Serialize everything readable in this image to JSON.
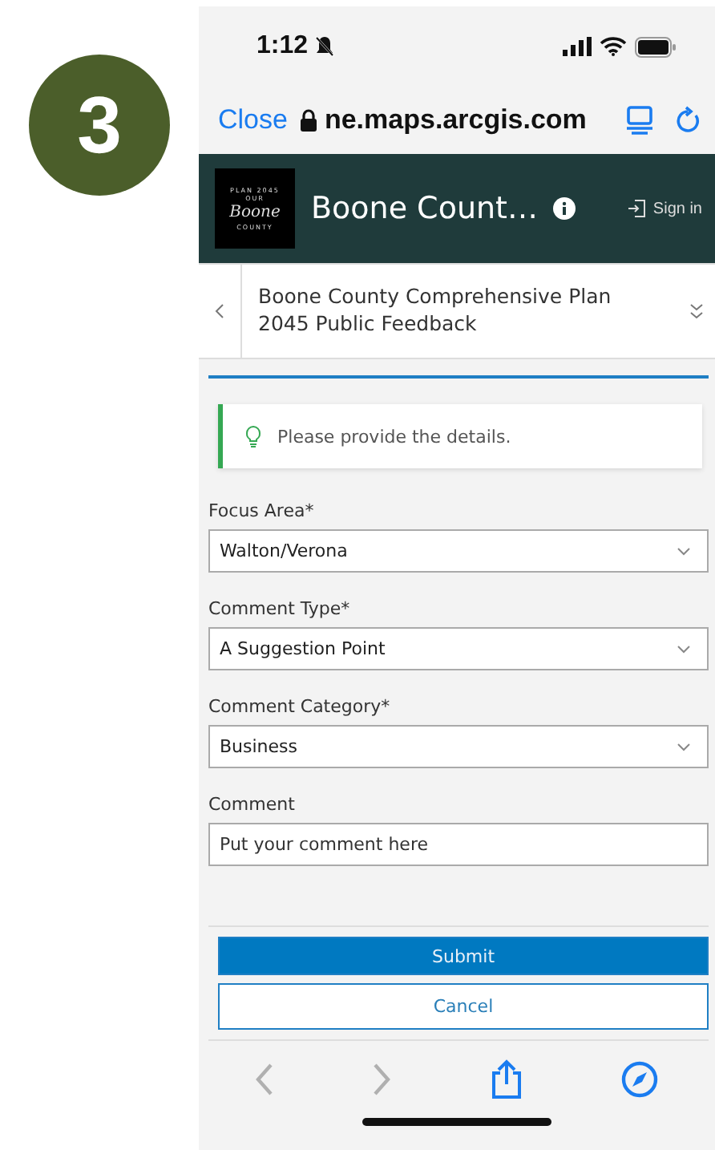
{
  "step_badge": {
    "number": "3"
  },
  "status_bar": {
    "time": "1:12"
  },
  "browser": {
    "close": "Close",
    "url": "ne.maps.arcgis.com"
  },
  "app_header": {
    "logo_lines": [
      "PLAN 2045",
      "OUR",
      "Boone",
      "COUNTY"
    ],
    "title": "Boone Count…",
    "sign_in": "Sign in"
  },
  "form_header": {
    "title": "Boone County Comprehensive Plan 2045 Public Feedback"
  },
  "tip": {
    "text": "Please provide the details."
  },
  "fields": [
    {
      "kind": "select",
      "label": "Focus Area*",
      "value": "Walton/Verona"
    },
    {
      "kind": "select",
      "label": "Comment Type*",
      "value": "A Suggestion Point"
    },
    {
      "kind": "select",
      "label": "Comment Category*",
      "value": "Business"
    },
    {
      "kind": "text",
      "label": "Comment",
      "placeholder": "Put your comment here"
    }
  ],
  "buttons": [
    {
      "kind": "primary",
      "label": "Submit"
    },
    {
      "kind": "secondary",
      "label": "Cancel"
    }
  ],
  "toolbar": [
    {
      "kind": "back",
      "disabled": true
    },
    {
      "kind": "forward",
      "disabled": true
    },
    {
      "kind": "share",
      "disabled": false
    },
    {
      "kind": "compass",
      "disabled": false
    }
  ]
}
